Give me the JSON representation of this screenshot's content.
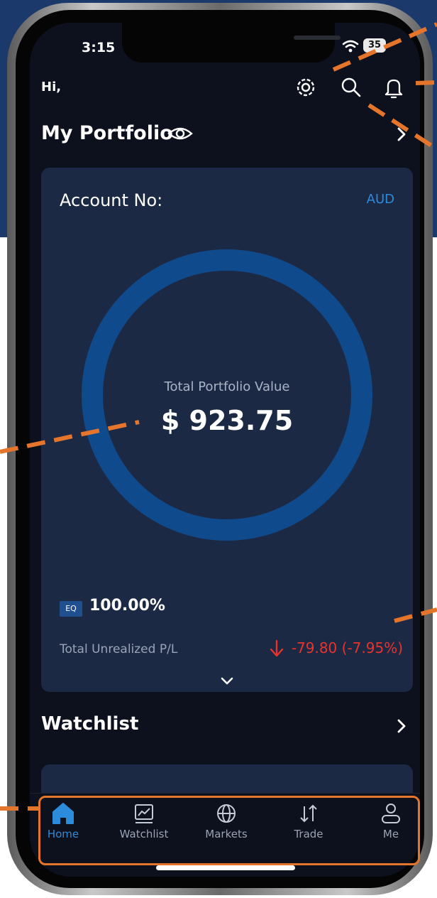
{
  "status_bar": {
    "time": "3:15",
    "battery": "35"
  },
  "header": {
    "greeting": "Hi,"
  },
  "portfolio": {
    "title": "My Portfolio",
    "account_label": "Account No:",
    "currency": "AUD",
    "total_label": "Total Portfolio Value",
    "total_value": "$ 923.75",
    "allocation_code": "EQ",
    "allocation_percent": "100.00%",
    "unrealized_label": "Total Unrealized P/L",
    "unrealized_value": "-79.80 (-7.95%)"
  },
  "watchlist": {
    "title": "Watchlist"
  },
  "tabs": [
    {
      "label": "Home",
      "icon": "home-icon",
      "active": true
    },
    {
      "label": "Watchlist",
      "icon": "chart-icon",
      "active": false
    },
    {
      "label": "Markets",
      "icon": "globe-icon",
      "active": false
    },
    {
      "label": "Trade",
      "icon": "trade-arrows-icon",
      "active": false
    },
    {
      "label": "Me",
      "icon": "person-icon",
      "active": false
    }
  ],
  "colors": {
    "background": "#0c111d",
    "card": "#1c2944",
    "accent": "#2d8bdb",
    "negative": "#e8332c",
    "donut_ring": "#0f4a8c",
    "annotation": "#e5752a"
  }
}
